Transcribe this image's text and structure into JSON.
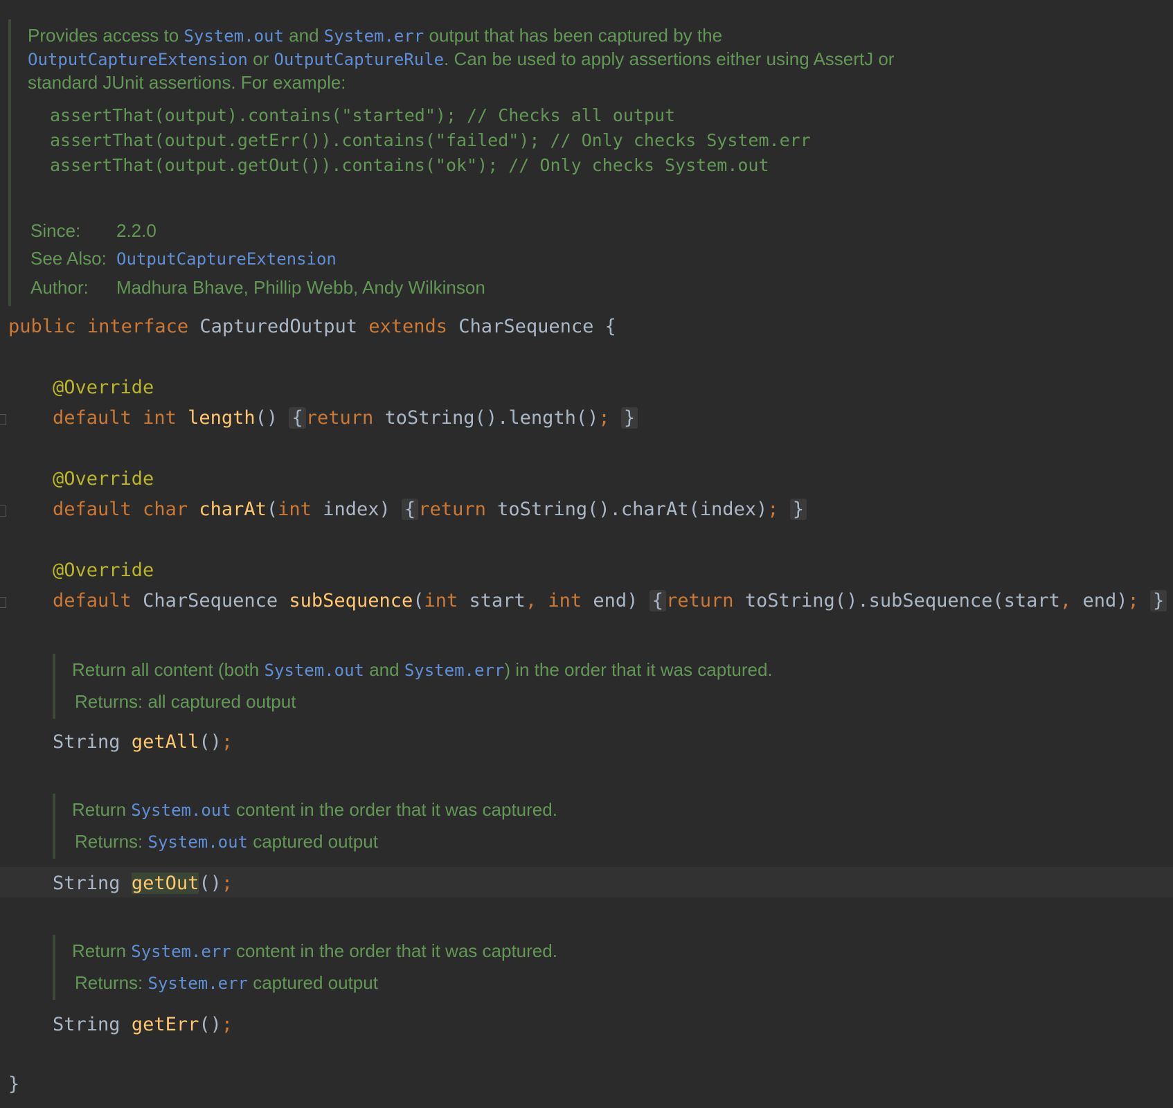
{
  "class_doc": {
    "line1": {
      "a": "Provides access to ",
      "l1": "System.out",
      "b": " and ",
      "l2": "System.err",
      "c": " output that has been captured by the"
    },
    "line2": {
      "l1": "OutputCaptureExtension",
      "a": " or ",
      "l2": "OutputCaptureRule",
      "b": ". Can be used to apply assertions either using AssertJ or"
    },
    "line3": "standard JUnit assertions. For example:",
    "examples": [
      "assertThat(output).contains(\"started\"); // Checks all output",
      "assertThat(output.getErr()).contains(\"failed\"); // Only checks System.err",
      "assertThat(output.getOut()).contains(\"ok\"); // Only checks System.out"
    ],
    "since_label": "Since:",
    "since_value": "2.2.0",
    "see_also_label": "See Also:",
    "see_also_value": "OutputCaptureExtension",
    "author_label": "Author:",
    "author_value": "Madhura Bhave, Phillip Webb, Andy Wilkinson"
  },
  "decl": {
    "public": "public",
    "interface": "interface",
    "name": "CapturedOutput",
    "extends": "extends",
    "super": "CharSequence",
    "brace": "{",
    "close": "}"
  },
  "methods": {
    "annotation": "@Override",
    "length": {
      "default": "default",
      "type": "int",
      "name": "length",
      "sig": "()",
      "open": "{",
      "ret": "return",
      "body": "toString().length()",
      "semi": ";",
      "close": "}"
    },
    "charAt": {
      "default": "default",
      "type": "char",
      "name": "charAt",
      "p_open": "(",
      "p_type": "int",
      "p_name": "index)",
      "open": "{",
      "ret": "return",
      "body": "toString().charAt(index)",
      "semi": ";",
      "close": "}"
    },
    "subSequence": {
      "default": "default",
      "type": "CharSequence",
      "name": "subSequence",
      "p_open": "(",
      "p1_type": "int",
      "p1_name": "start",
      "comma": ",",
      "p2_type": "int",
      "p2_name": "end)",
      "open": "{",
      "ret": "return",
      "body1": "toString().subSequence(start",
      "body_comma": ",",
      "body2": " end)",
      "semi": ";",
      "close": "}"
    }
  },
  "getAll": {
    "doc": {
      "a": "Return all content (both ",
      "l1": "System.out",
      "b": " and ",
      "l2": "System.err",
      "c": ") in the order that it was captured."
    },
    "returns_label": "Returns:",
    "returns_value": "all captured output",
    "type": "String",
    "name": "getAll",
    "parens": "()",
    "semi": ";"
  },
  "getOut": {
    "doc": {
      "a": "Return ",
      "l1": "System.out",
      "b": " content in the order that it was captured."
    },
    "returns_label": "Returns:",
    "returns_link": "System.out",
    "returns_value": " captured output",
    "type": "String",
    "name": "getOut",
    "parens": "()",
    "semi": ";"
  },
  "getErr": {
    "doc": {
      "a": "Return ",
      "l1": "System.err",
      "b": " content in the order that it was captured."
    },
    "returns_label": "Returns:",
    "returns_link": "System.err",
    "returns_value": " captured output",
    "type": "String",
    "name": "getErr",
    "parens": "()",
    "semi": ";"
  }
}
